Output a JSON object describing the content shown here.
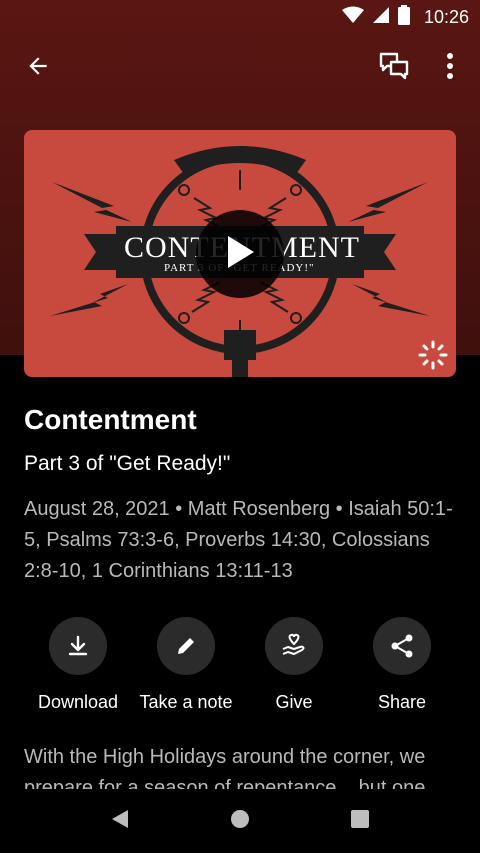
{
  "status_bar": {
    "time": "10:26",
    "icons": [
      "wifi-icon",
      "cell-signal-icon",
      "battery-icon"
    ]
  },
  "toolbar": {
    "back_icon": "arrow-left-icon",
    "chat_icon": "chat-bubbles-icon",
    "more_icon": "more-vert-icon"
  },
  "artwork": {
    "title_text": "CONTENTMENT",
    "subtitle_text": "PART 3 OF \"GET READY!\"",
    "play_icon": "play-icon",
    "badge_icon": "sunburst-icon",
    "colors": {
      "background": "#c8493d",
      "ink": "#1f1f1f"
    }
  },
  "sermon": {
    "title": "Contentment",
    "subtitle": "Part 3 of \"Get Ready!\"",
    "meta": "August 28, 2021 • Matt Rosenberg • Isaiah 50:1-5, Psalms 73:3-6, Proverbs 14:30, Colossians 2:8-10, 1 Corinthians 13:11-13"
  },
  "actions": [
    {
      "label": "Download",
      "icon": "download-icon"
    },
    {
      "label": "Take a note",
      "icon": "pencil-icon"
    },
    {
      "label": "Give",
      "icon": "hand-heart-icon"
    },
    {
      "label": "Share",
      "icon": "share-icon"
    }
  ],
  "description": "With the High Holidays around the corner, we prepare for a season of repentance... but one",
  "nav": {
    "back_icon": "nav-back-icon",
    "home_icon": "nav-home-icon",
    "recents_icon": "nav-recents-icon"
  }
}
